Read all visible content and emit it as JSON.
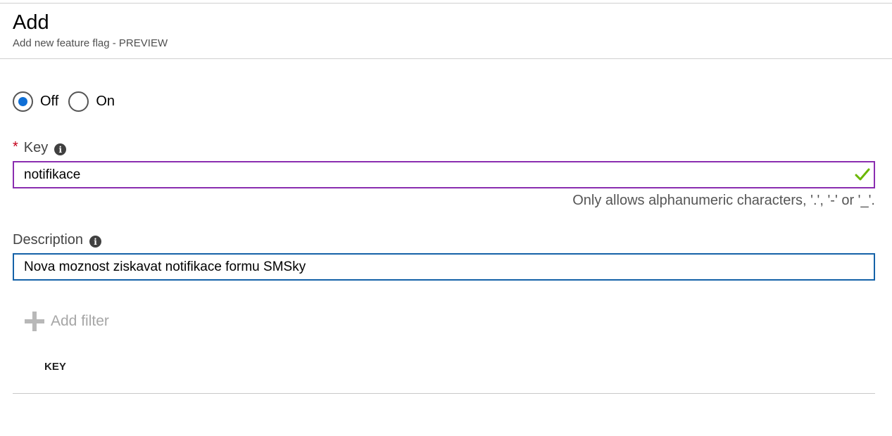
{
  "header": {
    "title": "Add",
    "subtitle": "Add new feature flag - PREVIEW"
  },
  "state": {
    "options": [
      {
        "label": "Off",
        "checked": true
      },
      {
        "label": "On",
        "checked": false
      }
    ]
  },
  "key": {
    "required_mark": "*",
    "label": "Key",
    "value": "notifikace",
    "valid_icon": "checkmark-icon",
    "helper": "Only allows alphanumeric characters, '.', '-' or '_'."
  },
  "description": {
    "label": "Description",
    "value": "Nova moznost ziskavat notifikace formu SMSky"
  },
  "filters": {
    "add_label": "Add filter",
    "columns": [
      "KEY"
    ]
  },
  "colors": {
    "radio_accent": "#0f6fd6",
    "key_border": "#8a2db0",
    "description_border": "#1562a8",
    "valid_check": "#6bb700",
    "required": "#c4001a"
  }
}
